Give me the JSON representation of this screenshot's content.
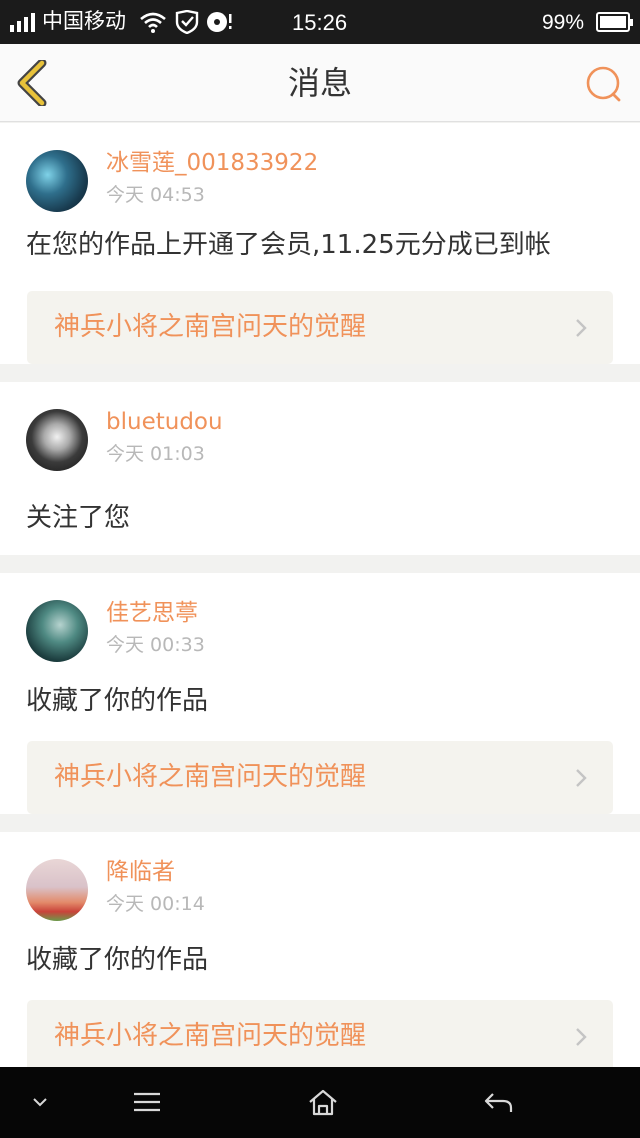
{
  "status_bar": {
    "carrier": "中国移动",
    "time": "15:26",
    "battery_percent": "99%",
    "battery_level": 0.99,
    "icons": [
      "signal-icon",
      "wifi-icon",
      "shield-icon",
      "disc-icon",
      "battery-icon"
    ]
  },
  "nav": {
    "title": "消息",
    "back_icon": "chevron-left-icon",
    "search_icon": "search-icon",
    "accent_color": "#f0925a"
  },
  "messages": [
    {
      "user": "冰雪莲_001833922",
      "time": "今天 04:53",
      "text": "在您的作品上开通了会员,11.25元分成已到帐",
      "work": "神兵小将之南宫问天的觉醒"
    },
    {
      "user": "bluetudou",
      "time": "今天 01:03",
      "text": "关注了您"
    },
    {
      "user": "佳艺思葶",
      "time": "今天 00:33",
      "text": "收藏了你的作品",
      "work": "神兵小将之南宫问天的觉醒"
    },
    {
      "user": "降临者",
      "time": "今天 00:14",
      "text": "收藏了你的作品",
      "work": "神兵小将之南宫问天的觉醒"
    }
  ],
  "system_nav": {
    "icons": [
      "chevron-down-icon",
      "menu-icon",
      "home-icon",
      "back-arrow-icon"
    ]
  }
}
